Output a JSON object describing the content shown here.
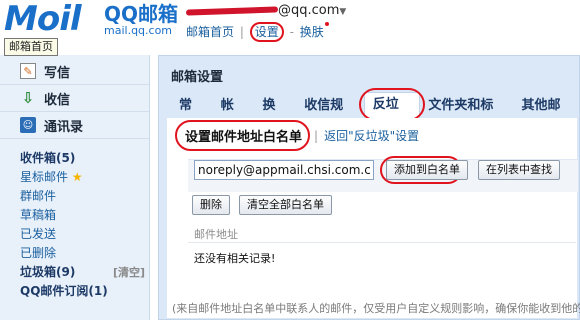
{
  "header": {
    "logo": "Moil",
    "brand_cn": "QQ邮箱",
    "brand_url": "mail.qq.com",
    "email_suffix": "@qq.com",
    "links": {
      "home": "邮箱首页",
      "settings": "设置",
      "skin": "换肤"
    },
    "tooltip": "邮箱首页"
  },
  "sidebar": {
    "actions": [
      {
        "label": "写信",
        "icon": "compose-icon"
      },
      {
        "label": "收信",
        "icon": "inbox-download-icon"
      },
      {
        "label": "通讯录",
        "icon": "contacts-icon"
      }
    ],
    "folders": [
      {
        "label": "收件箱(5)"
      },
      {
        "label": "星标邮件"
      },
      {
        "label": "群邮件"
      },
      {
        "label": "草稿箱"
      },
      {
        "label": "已发送"
      },
      {
        "label": "已删除"
      },
      {
        "label": "垃圾箱(9)"
      },
      {
        "label": "QQ邮件订阅(1)"
      }
    ],
    "clear_label": "[清空]"
  },
  "main": {
    "title": "邮箱设置",
    "tabs": [
      "常规",
      "帐户",
      "换肤",
      "收信规则",
      "反垃圾",
      "文件夹和标签",
      "其他邮箱"
    ],
    "active_tab": "反垃圾",
    "subheader": {
      "title": "设置邮件地址白名单",
      "back_link": "返回\"反垃圾\"设置"
    },
    "form": {
      "email_value": "noreply@appmail.chsi.com.cn",
      "add_button": "添加到白名单",
      "find_button": "在列表中查找",
      "delete_button": "删除",
      "clear_button": "清空全部白名单"
    },
    "list": {
      "column_header": "邮件地址",
      "empty_text": "还没有相关记录!"
    },
    "footer_note": "(来自邮件地址白名单中联系人的邮件，仅受用户自定义规则影响，确保你能收到他的邮件"
  }
}
